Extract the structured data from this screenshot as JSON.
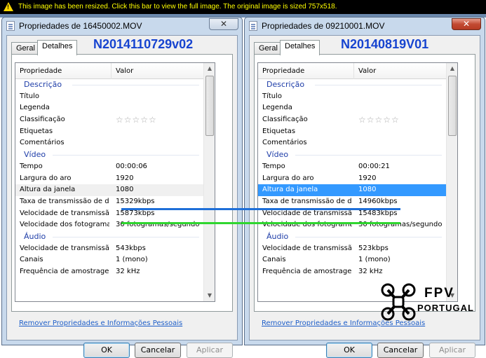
{
  "banner": {
    "text": "This image has been resized. Click this bar to view the full image. The original image is sized 757x518."
  },
  "left": {
    "title": "Propriedades de 16450002.MOV",
    "heading": "N2014110729v02",
    "tabs": [
      "Geral",
      "Detalhes"
    ],
    "columns": [
      "Propriedade",
      "Valor"
    ],
    "rows": [
      {
        "type": "group",
        "k": "Descrição"
      },
      {
        "k": "Título",
        "v": ""
      },
      {
        "k": "Legenda",
        "v": ""
      },
      {
        "k": "Classificação",
        "stars": "☆☆☆☆☆"
      },
      {
        "k": "Etiquetas",
        "v": ""
      },
      {
        "k": "Comentários",
        "v": ""
      },
      {
        "type": "group",
        "k": "Vídeo"
      },
      {
        "k": "Tempo",
        "v": "00:00:06"
      },
      {
        "k": "Largura do aro",
        "v": "1920"
      },
      {
        "k": "Altura da janela",
        "v": "1080",
        "sel": "grey"
      },
      {
        "k": "Taxa de transmissão de d...",
        "v": "15329kbps"
      },
      {
        "k": "Velocidade de transmissão...",
        "v": "15873kbps"
      },
      {
        "k": "Velocidade dos fotogramas",
        "v": "30 fotogramas/segundo"
      },
      {
        "type": "group",
        "k": "Áudio"
      },
      {
        "k": "Velocidade de transmissão",
        "v": "543kbps"
      },
      {
        "k": "Canais",
        "v": "1 (mono)"
      },
      {
        "k": "Frequência de amostrage...",
        "v": "32 kHz"
      }
    ],
    "link": "Remover Propriedades e Informações Pessoais",
    "buttons": {
      "ok": "OK",
      "cancel": "Cancelar",
      "apply": "Aplicar"
    },
    "close": "✕"
  },
  "right": {
    "title": "Propriedades de 09210001.MOV",
    "heading": "N20140819V01",
    "tabs": [
      "Geral",
      "Detalhes"
    ],
    "columns": [
      "Propriedade",
      "Valor"
    ],
    "rows": [
      {
        "type": "group",
        "k": "Descrição"
      },
      {
        "k": "Título",
        "v": ""
      },
      {
        "k": "Legenda",
        "v": ""
      },
      {
        "k": "Classificação",
        "stars": "☆☆☆☆☆"
      },
      {
        "k": "Etiquetas",
        "v": ""
      },
      {
        "k": "Comentários",
        "v": ""
      },
      {
        "type": "group",
        "k": "Vídeo"
      },
      {
        "k": "Tempo",
        "v": "00:00:21"
      },
      {
        "k": "Largura do aro",
        "v": "1920"
      },
      {
        "k": "Altura da janela",
        "v": "1080",
        "sel": "blue"
      },
      {
        "k": "Taxa de transmissão de d...",
        "v": "14960kbps"
      },
      {
        "k": "Velocidade de transmissão...",
        "v": "15483kbps"
      },
      {
        "k": "Velocidade dos fotogramas",
        "v": "30 fotogramas/segundo"
      },
      {
        "type": "group",
        "k": "Áudio"
      },
      {
        "k": "Velocidade de transmissão",
        "v": "523kbps"
      },
      {
        "k": "Canais",
        "v": "1 (mono)"
      },
      {
        "k": "Frequência de amostrage...",
        "v": "32 kHz"
      }
    ],
    "link": "Remover Propriedades e Informações Pessoais",
    "buttons": {
      "ok": "OK",
      "cancel": "Cancelar",
      "apply": "Aplicar"
    },
    "close": "✕"
  },
  "logo": {
    "line1": "FPV",
    "line2": "PORTUGAL"
  },
  "colors": {
    "blue_line": "#1f6fd8",
    "green_line": "#2fd62f",
    "heading": "#1744d0"
  }
}
